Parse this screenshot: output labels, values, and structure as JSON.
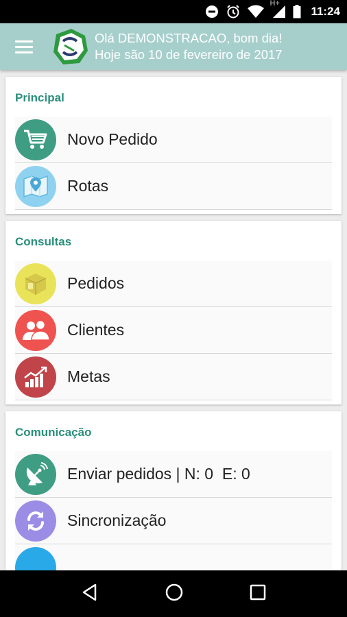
{
  "status_bar": {
    "icons": [
      "do-not-disturb-icon",
      "alarm-icon",
      "wifi-icon",
      "signal-icon",
      "battery-icon"
    ],
    "network_type": "H+",
    "time": "11:24"
  },
  "app_bar": {
    "menu_icon": "hamburger-menu-icon",
    "greeting_line1": "Olá DEMONSTRACAO, bom dia!",
    "greeting_line2": "Hoje são 10 de fevereiro de 2017",
    "color": "#a6cfcc"
  },
  "sections": [
    {
      "title": "Principal",
      "items": [
        {
          "label": "Novo Pedido",
          "icon": "shopping-cart-icon",
          "color": "#3f9d84"
        },
        {
          "label": "Rotas",
          "icon": "map-pin-icon",
          "color": "#8fd2f0"
        }
      ]
    },
    {
      "title": "Consultas",
      "items": [
        {
          "label": "Pedidos",
          "icon": "box-icon",
          "color": "#e9e35a"
        },
        {
          "label": "Clientes",
          "icon": "users-icon",
          "color": "#ef5350"
        },
        {
          "label": "Metas",
          "icon": "chart-icon",
          "color": "#c0444a"
        }
      ]
    },
    {
      "title": "Comunicação",
      "items": [
        {
          "label": "Enviar pedidos | N: 0  E: 0",
          "icon": "satellite-dish-icon",
          "color": "#3f9d84"
        },
        {
          "label": "Sincronização",
          "icon": "sync-icon",
          "color": "#9b8de6"
        }
      ]
    }
  ],
  "nav_bar": {
    "icons": [
      "back-icon",
      "home-icon",
      "recents-icon"
    ]
  },
  "colors": {
    "accent": "#2a8f7b"
  }
}
